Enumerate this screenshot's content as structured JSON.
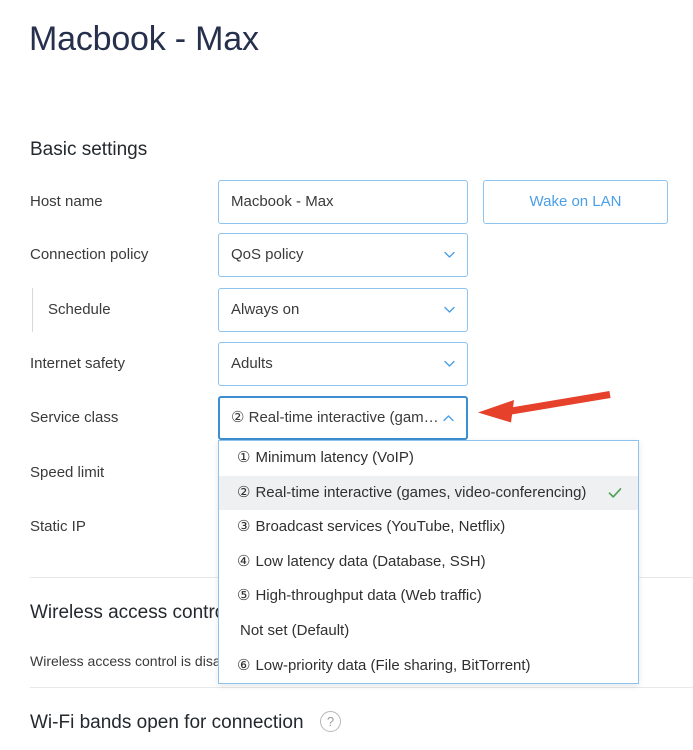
{
  "page_title": "Macbook - Max",
  "sections": {
    "basic_settings_heading": "Basic settings",
    "wireless_access_control_heading": "Wireless access control",
    "wireless_access_control_description": "Wireless access control is disabled",
    "wifi_bands_heading": "Wi-Fi bands open for connection",
    "help_icon_glyph": "?"
  },
  "rows": {
    "host_name": {
      "label": "Host name",
      "value": "Macbook - Max"
    },
    "connection_policy": {
      "label": "Connection policy",
      "value": "QoS policy"
    },
    "schedule": {
      "label": "Schedule",
      "value": "Always on"
    },
    "internet_safety": {
      "label": "Internet safety",
      "value": "Adults"
    },
    "service_class": {
      "label": "Service class",
      "value_number": "②",
      "value_text": "Real-time interactive (gam…"
    },
    "speed_limit": {
      "label": "Speed limit"
    },
    "static_ip": {
      "label": "Static IP"
    }
  },
  "buttons": {
    "wake_on_lan": "Wake on LAN"
  },
  "service_class_dropdown": {
    "open": true,
    "options": [
      {
        "number": "①",
        "label": "Minimum latency (VoIP)",
        "selected": false
      },
      {
        "number": "②",
        "label": "Real-time interactive (games, video-conferencing)",
        "selected": true
      },
      {
        "number": "③",
        "label": "Broadcast services (YouTube, Netflix)",
        "selected": false
      },
      {
        "number": "④",
        "label": "Low latency data (Database, SSH)",
        "selected": false
      },
      {
        "number": "⑤",
        "label": "High-throughput data (Web traffic)",
        "selected": false
      },
      {
        "number": "",
        "label": "Not set (Default)",
        "selected": false
      },
      {
        "number": "⑥",
        "label": "Low-priority data (File sharing, BitTorrent)",
        "selected": false
      }
    ]
  },
  "annotation": {
    "arrow_color": "#e5412b",
    "points_at": "service-class-select"
  },
  "colors": {
    "title": "#26304d",
    "accent_blue": "#4a9fe8",
    "border_blue": "#8cc3ef",
    "focus_blue": "#3d8fd1",
    "check_green": "#52a15c",
    "selected_row_bg": "#eff0f1",
    "divider": "#e8e8e8"
  }
}
